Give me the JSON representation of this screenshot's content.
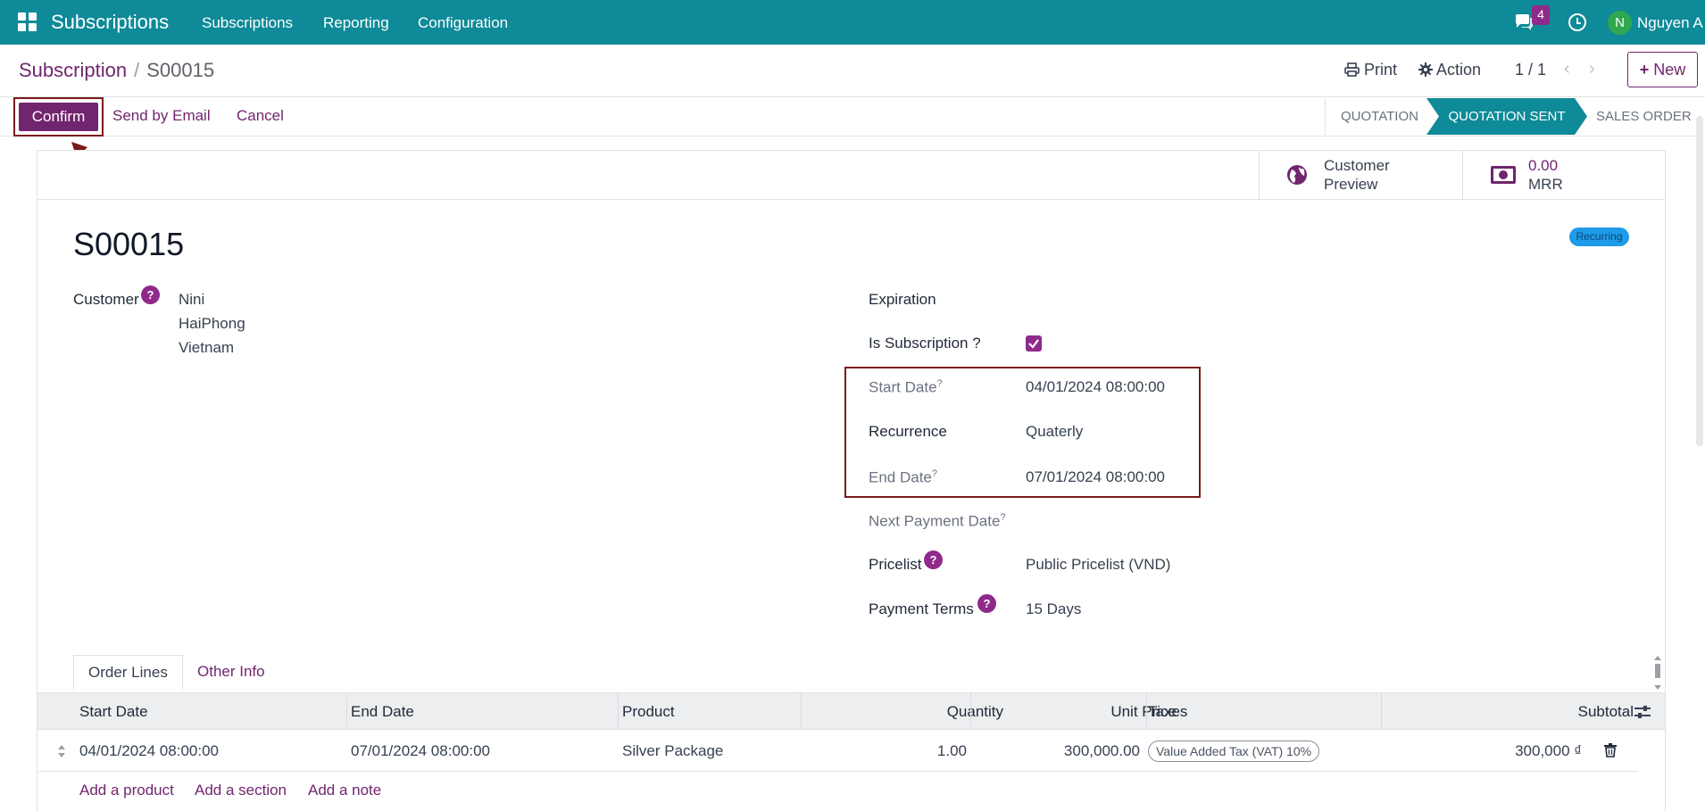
{
  "topbar": {
    "app_name": "Subscriptions",
    "menus": [
      "Subscriptions",
      "Reporting",
      "Configuration"
    ],
    "notification_count": "4",
    "avatar_initial": "N",
    "user_name": "Nguyen A"
  },
  "control_panel": {
    "breadcrumb_parent": "Subscription",
    "breadcrumb_separator": "/",
    "breadcrumb_current": "S00015",
    "print_label": "Print",
    "action_label": "Action",
    "pager": "1 / 1",
    "new_label": "New"
  },
  "statusbar": {
    "confirm_label": "Confirm",
    "send_email_label": "Send by Email",
    "cancel_label": "Cancel",
    "stages": [
      "QUOTATION",
      "QUOTATION SENT",
      "SALES ORDER"
    ],
    "active_stage": "QUOTATION SENT"
  },
  "smart_buttons": {
    "preview_line1": "Customer",
    "preview_line2": "Preview",
    "mrr_value": "0.00",
    "mrr_label": "MRR"
  },
  "record": {
    "name": "S00015",
    "ribbon": "Recurring"
  },
  "fields": {
    "customer_label": "Customer",
    "customer_lines": [
      "Nini",
      "HaiPhong",
      "Vietnam"
    ],
    "expiration_label": "Expiration",
    "is_subscription_label": "Is Subscription ?",
    "is_subscription_checked": true,
    "start_date_label": "Start Date",
    "start_date_value": "04/01/2024 08:00:00",
    "recurrence_label": "Recurrence",
    "recurrence_value": "Quaterly",
    "end_date_label": "End Date",
    "end_date_value": "07/01/2024 08:00:00",
    "next_payment_label": "Next Payment Date",
    "pricelist_label": "Pricelist",
    "pricelist_value": "Public Pricelist (VND)",
    "payment_terms_label": "Payment Terms",
    "payment_terms_value": "15 Days",
    "help_mark": "?",
    "tooltip_mark": "?"
  },
  "tabs": [
    "Order Lines",
    "Other Info"
  ],
  "order_table": {
    "columns": [
      "Start Date",
      "End Date",
      "Product",
      "Quantity",
      "Unit Price",
      "Taxes",
      "Subtotal"
    ],
    "rows": [
      {
        "start_date": "04/01/2024 08:00:00",
        "end_date": "07/01/2024 08:00:00",
        "product": "Silver Package",
        "quantity": "1.00",
        "unit_price": "300,000.00",
        "tax": "Value Added Tax (VAT) 10%",
        "subtotal": "300,000 ₫"
      }
    ],
    "add_product": "Add a product",
    "add_section": "Add a section",
    "add_note": "Add a note"
  },
  "colors": {
    "topbar": "#0e8a98",
    "primary": "#71256e",
    "annotation": "#7b1a1a"
  }
}
